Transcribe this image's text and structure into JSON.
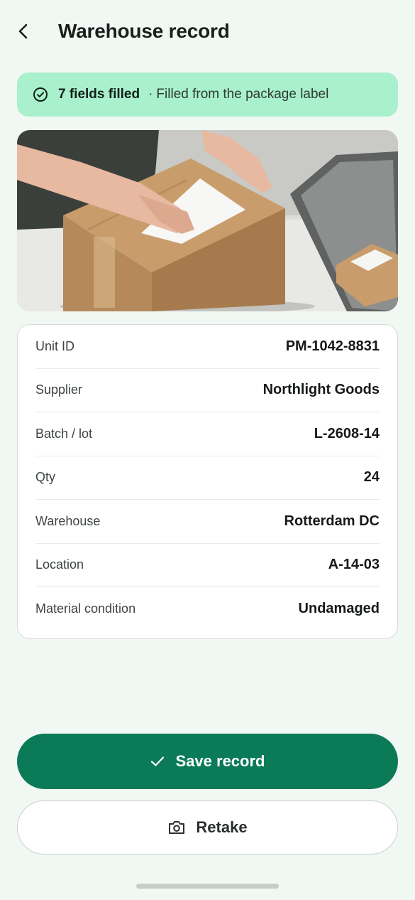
{
  "header": {
    "title": "Warehouse record",
    "back_icon": "chevron-left-icon"
  },
  "banner": {
    "icon": "check-circle-icon",
    "count_text": "7 fields filled",
    "separator": "·",
    "source_text": "Filled from the package label",
    "bg_color": "#a9f0cd"
  },
  "photo": {
    "description_icon": "package-photo"
  },
  "details": [
    {
      "label": "Unit ID",
      "value": "PM-1042-8831"
    },
    {
      "label": "Supplier",
      "value": "Northlight Goods"
    },
    {
      "label": "Batch / lot",
      "value": "L-2608-14"
    },
    {
      "label": "Qty",
      "value": "24"
    },
    {
      "label": "Warehouse",
      "value": "Rotterdam DC"
    },
    {
      "label": "Location",
      "value": "A-14-03"
    },
    {
      "label": "Material condition",
      "value": "Undamaged"
    }
  ],
  "actions": {
    "save_label": "Save record",
    "save_icon": "checkmark-icon",
    "retake_label": "Retake",
    "retake_icon": "camera-icon",
    "primary_color": "#0a7a57"
  }
}
